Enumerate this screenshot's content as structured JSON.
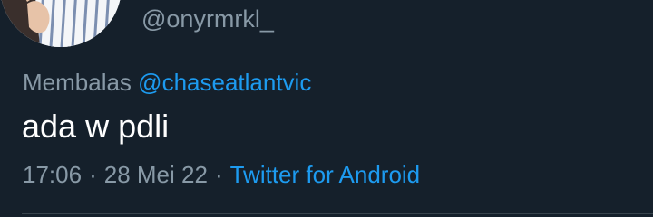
{
  "tweet": {
    "handle": "@onyrmrkl_",
    "reply_label": "Membalas",
    "reply_to": "@chaseatlantvic",
    "text": "ada w pdli",
    "time": "17:06",
    "separator": "·",
    "date": "28 Mei 22",
    "source": "Twitter for Android"
  },
  "colors": {
    "background": "#15202b",
    "secondary_text": "#8899a6",
    "link": "#1d9bf0",
    "primary_text": "#ffffff"
  },
  "icons": {
    "avatar": "profile-photo"
  }
}
